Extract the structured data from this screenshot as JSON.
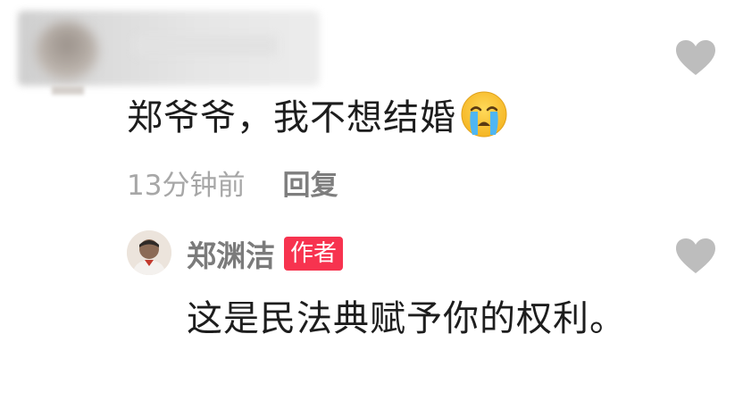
{
  "comment": {
    "text": "郑爷爷，我不想结婚",
    "emoji": "crying-face",
    "time": "13分钟前",
    "reply_label": "回复"
  },
  "reply": {
    "author": "郑渊洁",
    "badge": "作者",
    "text": "这是民法典赋予你的权利。"
  },
  "colors": {
    "badge_bg": "#f7334f",
    "heart": "#bdbdbd",
    "meta_text": "#a7a7a7"
  }
}
